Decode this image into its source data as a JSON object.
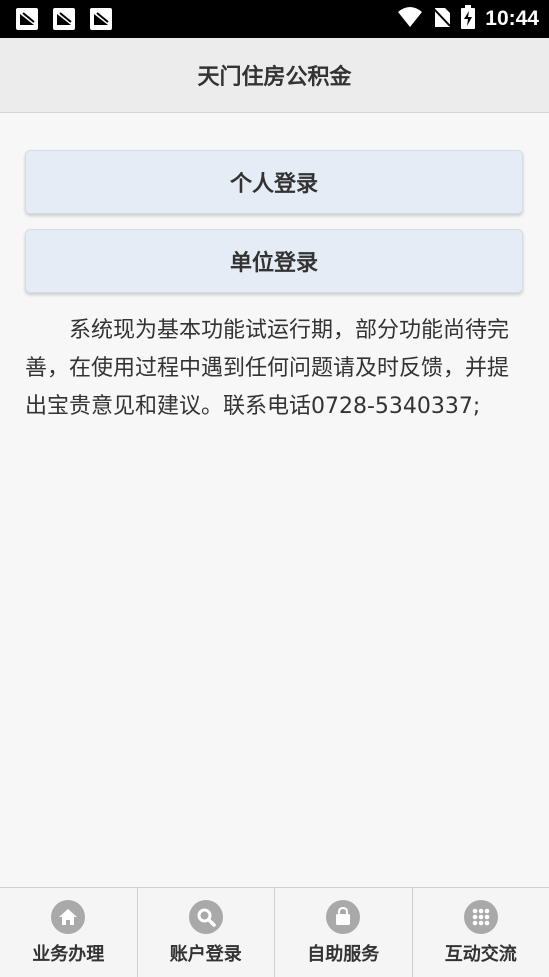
{
  "status_bar": {
    "time": "10:44",
    "left_icons": [
      "notification-icon",
      "notification-icon",
      "notification-icon"
    ],
    "right_icons": [
      "wifi-icon",
      "no-sim-icon",
      "battery-charging-icon"
    ]
  },
  "app_bar": {
    "title": "天门住房公积金"
  },
  "login": {
    "personal_label": "个人登录",
    "company_label": "单位登录"
  },
  "notice": {
    "text": "系统现为基本功能试运行期，部分功能尚待完善，在使用过程中遇到任何问题请及时反馈，并提出宝贵意见和建议。联系电话0728-5340337;"
  },
  "tabs": [
    {
      "label": "业务办理",
      "icon": "home-icon"
    },
    {
      "label": "账户登录",
      "icon": "search-icon"
    },
    {
      "label": "自助服务",
      "icon": "shopping-bag-icon"
    },
    {
      "label": "互动交流",
      "icon": "grid-icon"
    }
  ],
  "colors": {
    "status_bar_bg": "#000000",
    "app_bar_bg": "#ececec",
    "button_bg": "#e5ecf6",
    "icon_gray": "#a9a9a9"
  }
}
